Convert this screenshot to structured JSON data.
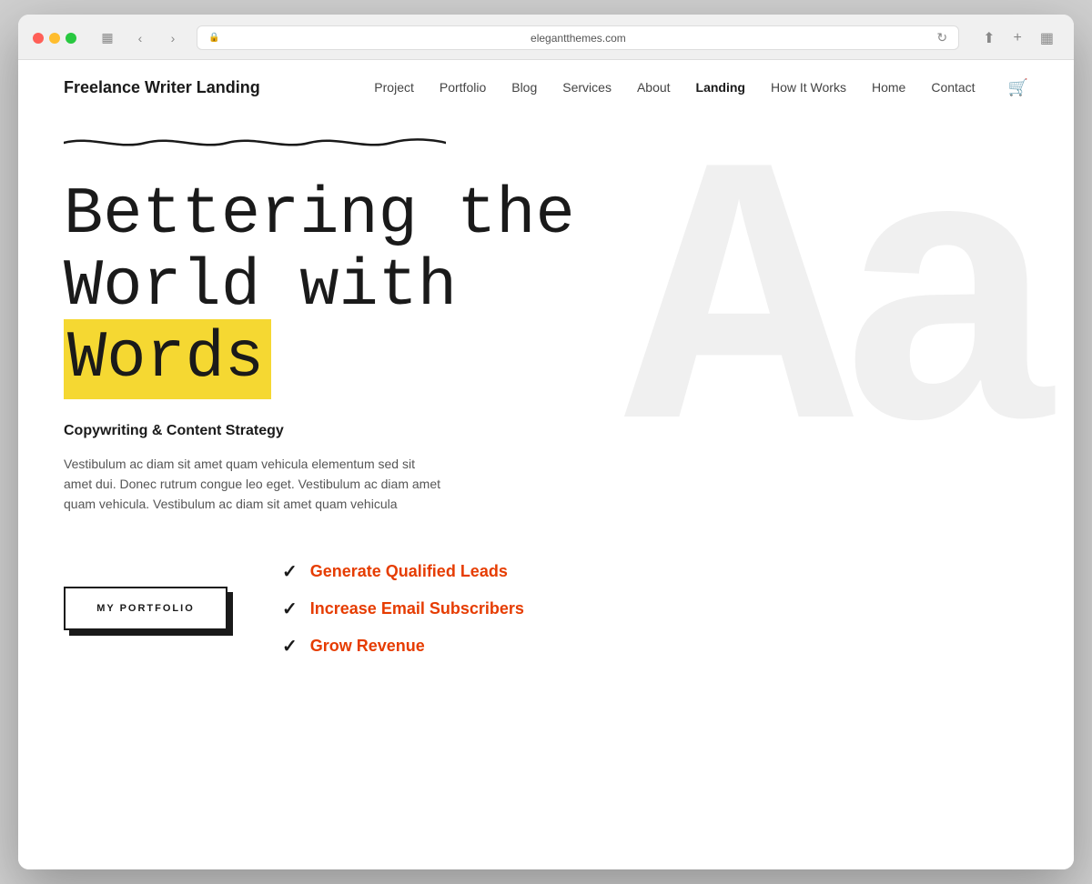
{
  "browser": {
    "url": "elegantthemes.com",
    "traffic_lights": [
      "red",
      "yellow",
      "green"
    ]
  },
  "nav": {
    "logo": "Freelance Writer Landing",
    "items": [
      {
        "label": "Project",
        "active": false
      },
      {
        "label": "Portfolio",
        "active": false
      },
      {
        "label": "Blog",
        "active": false
      },
      {
        "label": "Services",
        "active": false
      },
      {
        "label": "About",
        "active": false
      },
      {
        "label": "Landing",
        "active": true
      },
      {
        "label": "How It Works",
        "active": false
      },
      {
        "label": "Home",
        "active": false
      },
      {
        "label": "Contact",
        "active": false
      }
    ]
  },
  "hero": {
    "title_line1": "Bettering the",
    "title_line2": "World with",
    "title_line3": "Words",
    "subtitle": "Copywriting & Content Strategy",
    "description": "Vestibulum ac diam sit amet quam vehicula elementum sed sit amet dui. Donec rutrum congue leo eget. Vestibulum ac diam amet quam vehicula. Vestibulum ac diam sit amet quam vehicula",
    "bg_text": "Aa",
    "portfolio_btn": "MY PORTFOLIO",
    "checklist": [
      {
        "label": "Generate Qualified Leads"
      },
      {
        "label": "Increase Email Subscribers"
      },
      {
        "label": "Grow Revenue"
      }
    ]
  },
  "colors": {
    "accent_yellow": "#f5d832",
    "accent_red": "#e63c00",
    "dark": "#1a1a1a"
  }
}
